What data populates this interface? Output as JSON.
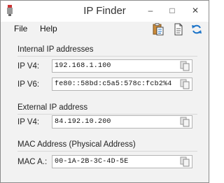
{
  "window": {
    "title": "IP Finder",
    "controls": {
      "minimize": "–",
      "maximize": "□",
      "close": "✕"
    }
  },
  "menu": {
    "file": "File",
    "help": "Help"
  },
  "toolbar": {
    "icons": [
      "clipboard-paste-icon",
      "document-icon",
      "refresh-icon"
    ]
  },
  "sections": {
    "internal": {
      "title": "Internal IP addresses",
      "ipv4": {
        "label": "IP V4:",
        "value": "192.168.1.100"
      },
      "ipv6": {
        "label": "IP V6:",
        "value": "fe80::58bd:c5a5:578c:fcb2%4"
      }
    },
    "external": {
      "title": "External IP address",
      "ipv4": {
        "label": "IP V4:",
        "value": "84.192.10.200"
      }
    },
    "mac": {
      "title": "MAC Address (Physical Address)",
      "address": {
        "label": "MAC A.:",
        "value": "00-1A-2B-3C-4D-5E"
      }
    }
  },
  "colors": {
    "accent": "#1a73c8",
    "window_bg": "#f2f2f2"
  }
}
